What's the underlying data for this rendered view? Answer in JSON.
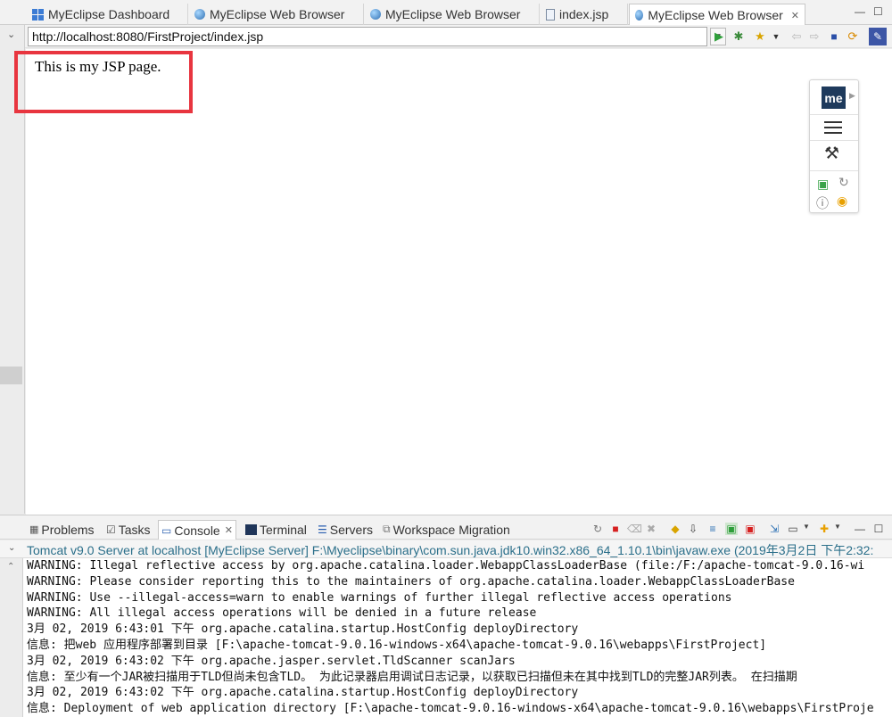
{
  "editor_tabs": [
    {
      "label": "MyEclipse Dashboard",
      "icon": "dashboard-icon"
    },
    {
      "label": "MyEclipse Web Browser",
      "icon": "globe-icon"
    },
    {
      "label": "MyEclipse Web Browser",
      "icon": "globe-icon"
    },
    {
      "label": "index.jsp",
      "icon": "jsp-file-icon"
    },
    {
      "label": "MyEclipse Web Browser",
      "icon": "globe-icon",
      "active": true,
      "close": "✕"
    }
  ],
  "window_controls": {
    "minimize": "—",
    "maximize": "☐"
  },
  "address_bar": {
    "url": "http://localhost:8080/FirstProject/index.jsp",
    "dropdown": "▼"
  },
  "browser_page": {
    "text": "This is my JSP page."
  },
  "widget": {
    "logo_text": "me"
  },
  "panel": {
    "tabs": [
      {
        "label": "Problems",
        "icon": "problems-icon"
      },
      {
        "label": "Tasks",
        "icon": "tasks-icon"
      },
      {
        "label": "Console",
        "icon": "console-icon",
        "active": true,
        "close": "✕"
      },
      {
        "label": "Terminal",
        "icon": "terminal-icon"
      },
      {
        "label": "Servers",
        "icon": "servers-icon"
      },
      {
        "label": "Workspace Migration",
        "icon": "migration-icon"
      }
    ],
    "console_description": "Tomcat v9.0 Server at localhost [MyEclipse Server] F:\\Myeclipse\\binary\\com.sun.java.jdk10.win32.x86_64_1.10.1\\bin\\javaw.exe (2019年3月2日 下午2:32:",
    "console_lines": [
      "WARNING: Illegal reflective access by org.apache.catalina.loader.WebappClassLoaderBase (file:/F:/apache-tomcat-9.0.16-wi",
      "WARNING: Please consider reporting this to the maintainers of org.apache.catalina.loader.WebappClassLoaderBase",
      "WARNING: Use --illegal-access=warn to enable warnings of further illegal reflective access operations",
      "WARNING: All illegal access operations will be denied in a future release",
      "3月 02, 2019 6:43:01 下午 org.apache.catalina.startup.HostConfig deployDirectory",
      "信息: 把web 应用程序部署到目录 [F:\\apache-tomcat-9.0.16-windows-x64\\apache-tomcat-9.0.16\\webapps\\FirstProject]",
      "3月 02, 2019 6:43:02 下午 org.apache.jasper.servlet.TldScanner scanJars",
      "信息: 至少有一个JAR被扫描用于TLD但尚未包含TLD。 为此记录器启用调试日志记录，以获取已扫描但未在其中找到TLD的完整JAR列表。 在扫描期",
      "3月 02, 2019 6:43:02 下午 org.apache.catalina.startup.HostConfig deployDirectory",
      "信息: Deployment of web application directory [F:\\apache-tomcat-9.0.16-windows-x64\\apache-tomcat-9.0.16\\webapps\\FirstProje"
    ]
  },
  "colors": {
    "highlight_box": "#e8353f",
    "console_description": "#2b6f8a",
    "widget_logo_bg": "#1e3a5c"
  }
}
